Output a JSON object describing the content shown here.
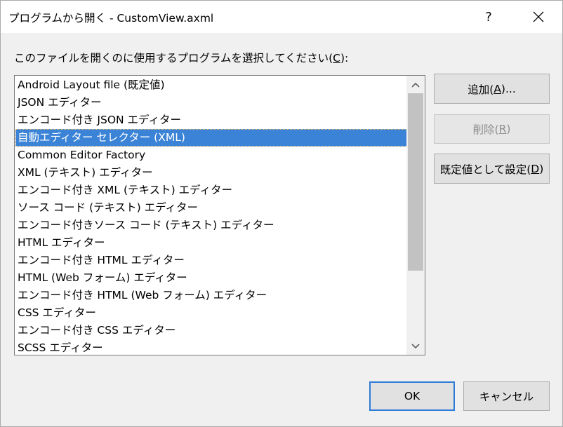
{
  "window": {
    "title": "プログラムから開く - CustomView.axml",
    "help_label": "?",
    "close_icon": "close-icon"
  },
  "prompt": {
    "before": "このファイルを開くのに使用するプログラムを選択してください(",
    "key": "C",
    "after": "):"
  },
  "programs": [
    "Android Layout file (既定値)",
    "JSON エディター",
    "エンコード付き JSON エディター",
    "自動エディター セレクター (XML)",
    "Common Editor Factory",
    "XML (テキスト) エディター",
    "エンコード付き XML (テキスト) エディター",
    "ソース コード (テキスト) エディター",
    "エンコード付きソース コード (テキスト) エディター",
    "HTML エディター",
    "エンコード付き HTML エディター",
    "HTML (Web フォーム) エディター",
    "エンコード付き HTML (Web フォーム) エディター",
    "CSS エディター",
    "エンコード付き CSS エディター",
    "SCSS エディター"
  ],
  "selected_index": 3,
  "buttons": {
    "add": {
      "before": "追加(",
      "key": "A",
      "after": ")..."
    },
    "remove": {
      "before": "削除(",
      "key": "R",
      "after": ")"
    },
    "set_default": {
      "before": "既定値として設定(",
      "key": "D",
      "after": ")"
    },
    "ok": "OK",
    "cancel": "キャンセル"
  },
  "colors": {
    "selection": "#3a83d6",
    "primary_border": "#2f7bd8",
    "dialog_background": "#f0f0f0"
  }
}
